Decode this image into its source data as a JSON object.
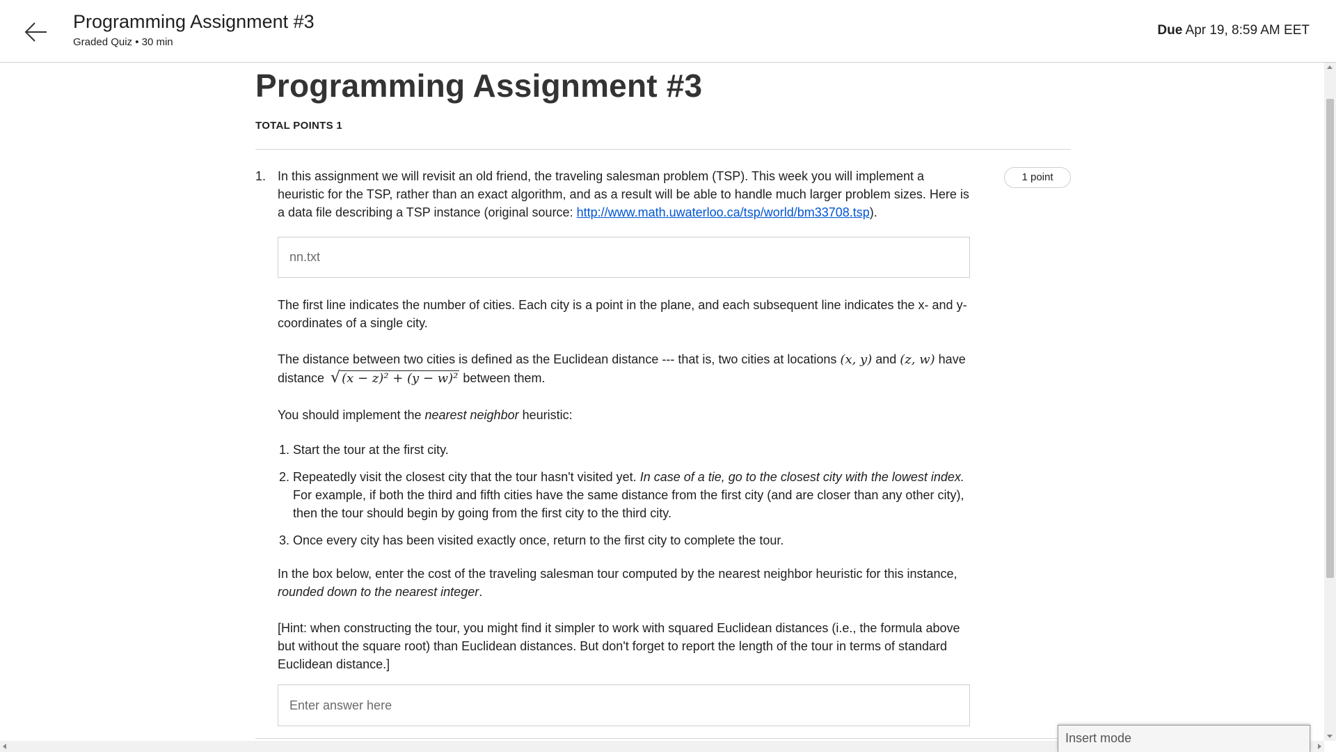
{
  "header": {
    "title": "Programming Assignment #3",
    "subtitle": "Graded Quiz • 30 min",
    "due_label": "Due",
    "due_value": "Apr 19, 8:59 AM EET"
  },
  "main": {
    "page_title": "Programming Assignment #3",
    "total_points": "TOTAL POINTS 1"
  },
  "question": {
    "number": "1.",
    "points": "1 point",
    "intro_text": "In this assignment we will revisit an old friend, the traveling salesman problem (TSP).  This week you will implement a heuristic for the TSP, rather than an exact algorithm, and as a result will be able to handle much larger problem sizes.  Here is a data file describing a TSP instance (original source: ",
    "link": "http://www.math.uwaterloo.ca/tsp/world/bm33708.tsp",
    "intro_end": ").",
    "file_name": "nn.txt",
    "para1": "The first line indicates the number of cities. Each city is a point in the plane, and each subsequent line indicates the x- and y-coordinates of a single city.",
    "para2_a": "The distance between two cities is defined as the Euclidean distance --- that is, two cities at locations ",
    "math_xy": "(x, y)",
    "para2_and": " and ",
    "math_zw": "(z, w)",
    "para2_b": " have distance ",
    "math_sqrt": "(x − z)² + (y − w)²",
    "para2_c": " between them.",
    "para3_a": "You should implement the ",
    "para3_em": "nearest neighbor",
    "para3_b": " heuristic:",
    "steps": [
      {
        "text": "Start the tour at the first city."
      },
      {
        "text_a": "Repeatedly visit the closest city that the tour hasn't visited yet.  ",
        "text_em": "In case of a tie, go to the closest city with the lowest index.",
        "text_b": "  For example, if both the third and fifth cities have the same distance from the first city (and are closer than any other city), then the tour should begin by going from the first city to the third city."
      },
      {
        "text": "Once every city has been visited exactly once, return to the first city to complete the tour."
      }
    ],
    "para4_a": "In the box below, enter the cost of the traveling salesman tour computed by the nearest neighbor heuristic for this instance, ",
    "para4_em": "rounded down to the nearest integer",
    "para4_b": ".",
    "para5": "[Hint: when constructing the tour, you might find it simpler to work with squared Euclidean distances (i.e., the formula above but without the square root) than Euclidean distances.  But don't forget to report the length of the tour in terms of standard Euclidean distance.]",
    "answer_placeholder": "Enter answer here"
  },
  "insert_mode": "Insert mode"
}
